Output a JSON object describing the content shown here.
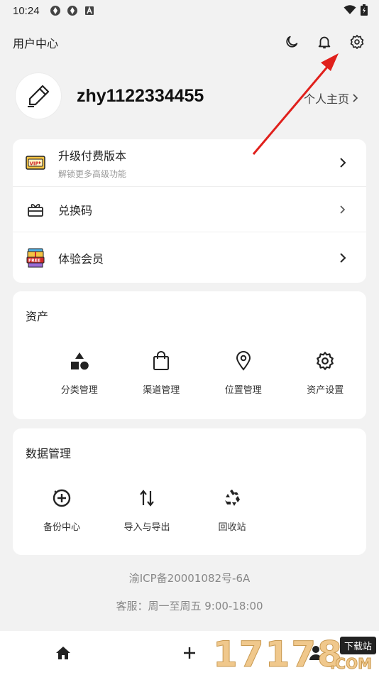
{
  "status_bar": {
    "time": "10:24"
  },
  "header": {
    "title": "用户中心"
  },
  "profile": {
    "username": "zhy1122334455",
    "homepage_label": "个人主页"
  },
  "menu": [
    {
      "label": "升级付费版本",
      "subtitle": "解锁更多高级功能",
      "icon": "vip-ticket-icon"
    },
    {
      "label": "兑换码",
      "icon": "gift-box-icon"
    },
    {
      "label": "体验会员",
      "icon": "free-gift-icon"
    }
  ],
  "assets": {
    "title": "资产",
    "items": [
      {
        "label": "分类管理",
        "icon": "shapes-icon"
      },
      {
        "label": "渠道管理",
        "icon": "shopping-bag-icon"
      },
      {
        "label": "位置管理",
        "icon": "location-pin-icon"
      },
      {
        "label": "资产设置",
        "icon": "gear-icon"
      }
    ]
  },
  "data_management": {
    "title": "数据管理",
    "items": [
      {
        "label": "备份中心",
        "icon": "backup-icon"
      },
      {
        "label": "导入与导出",
        "icon": "import-export-icon"
      },
      {
        "label": "回收站",
        "icon": "recycle-icon"
      }
    ]
  },
  "footer": {
    "icp": "渝ICP备20001082号-6A",
    "service": "客服：周一至周五 9:00-18:00"
  },
  "watermark": {
    "digits": "17178",
    "tag": "下载站",
    "domain": ".COM"
  },
  "colors": {
    "accent": "#222222",
    "annotation": "#e0201c",
    "background": "#f2f2f2"
  }
}
